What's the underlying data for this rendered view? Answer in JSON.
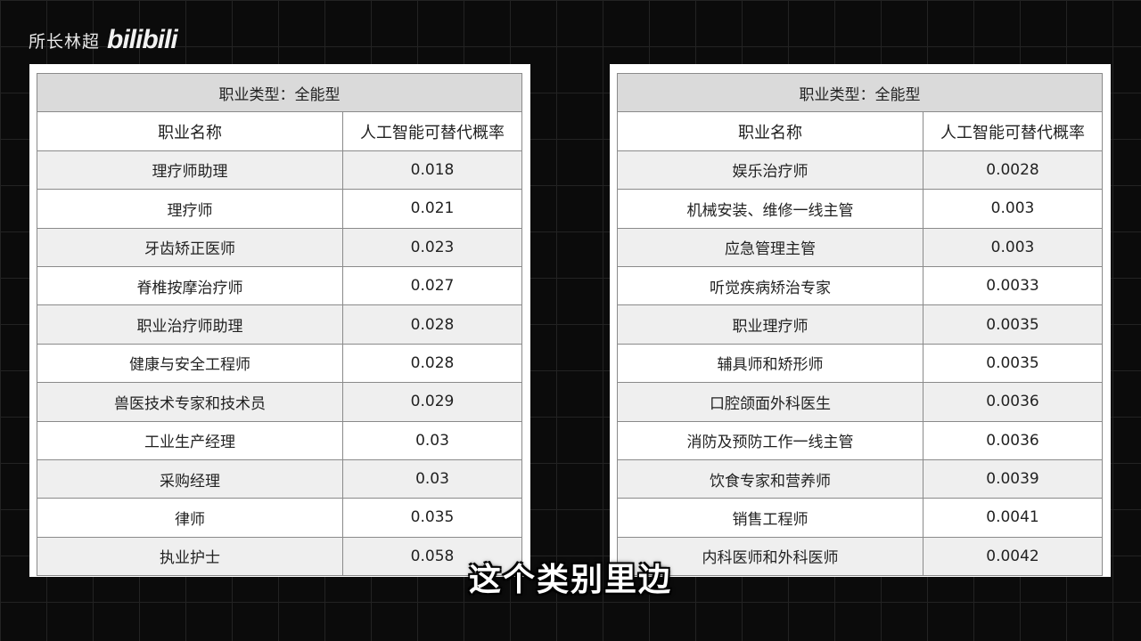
{
  "watermark": {
    "name": "所长林超",
    "logo": "bilibili"
  },
  "left_table": {
    "category": "职业类型：全能型",
    "headers": [
      "职业名称",
      "人工智能可替代概率"
    ],
    "rows": [
      [
        "理疗师助理",
        "0.018"
      ],
      [
        "理疗师",
        "0.021"
      ],
      [
        "牙齿矫正医师",
        "0.023"
      ],
      [
        "脊椎按摩治疗师",
        "0.027"
      ],
      [
        "职业治疗师助理",
        "0.028"
      ],
      [
        "健康与安全工程师",
        "0.028"
      ],
      [
        "兽医技术专家和技术员",
        "0.029"
      ],
      [
        "工业生产经理",
        "0.03"
      ],
      [
        "采购经理",
        "0.03"
      ],
      [
        "律师",
        "0.035"
      ],
      [
        "执业护士",
        "0.058"
      ]
    ]
  },
  "right_table": {
    "category": "职业类型：全能型",
    "headers": [
      "职业名称",
      "人工智能可替代概率"
    ],
    "rows": [
      [
        "娱乐治疗师",
        "0.0028"
      ],
      [
        "机械安装、维修一线主管",
        "0.003"
      ],
      [
        "应急管理主管",
        "0.003"
      ],
      [
        "听觉疾病矫治专家",
        "0.0033"
      ],
      [
        "职业理疗师",
        "0.0035"
      ],
      [
        "辅具师和矫形师",
        "0.0035"
      ],
      [
        "口腔颌面外科医生",
        "0.0036"
      ],
      [
        "消防及预防工作一线主管",
        "0.0036"
      ],
      [
        "饮食专家和营养师",
        "0.0039"
      ],
      [
        "销售工程师",
        "0.0041"
      ],
      [
        "内科医师和外科医师",
        "0.0042"
      ]
    ]
  },
  "subtitle": "这个类别里边"
}
